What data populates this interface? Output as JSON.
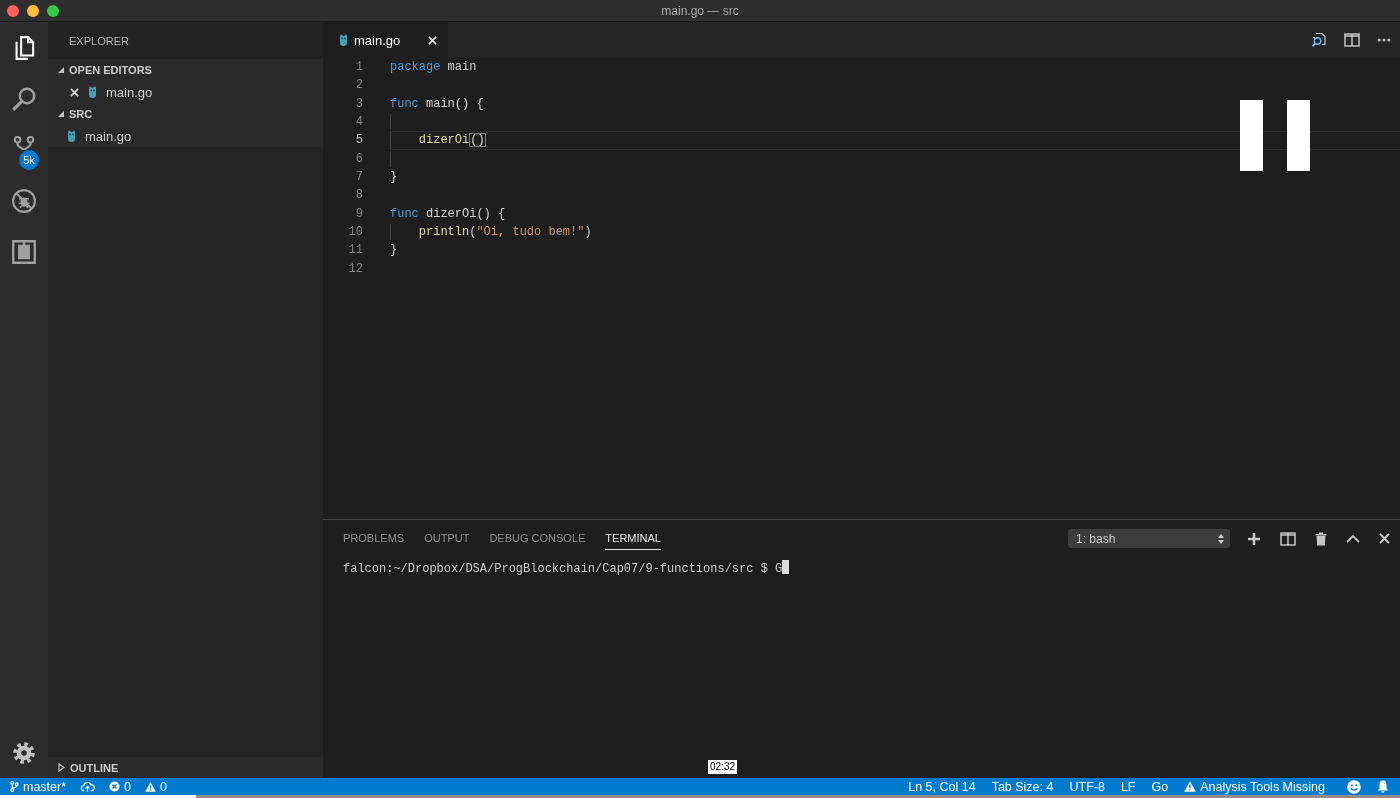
{
  "window": {
    "title": "main.go — src"
  },
  "activity_bar": {
    "items": [
      {
        "kind": "files",
        "selected": true
      },
      {
        "kind": "search",
        "selected": false
      },
      {
        "kind": "source_control",
        "selected": false,
        "badge": "5k"
      },
      {
        "kind": "debug",
        "selected": false
      },
      {
        "kind": "extensions",
        "selected": false
      }
    ]
  },
  "sidebar": {
    "title": "EXPLORER",
    "sections": [
      {
        "title": "OPEN EDITORS",
        "expanded": true,
        "items": [
          {
            "kind": "open_editor",
            "name": "main.go"
          }
        ]
      },
      {
        "title": "SRC",
        "expanded": true,
        "items": [
          {
            "kind": "file",
            "name": "main.go"
          }
        ]
      }
    ],
    "outline": {
      "title": "OUTLINE",
      "expanded": false
    }
  },
  "editor": {
    "tabs": [
      {
        "label": "main.go",
        "selected": true
      }
    ],
    "lines": [
      {
        "number": "1",
        "current": false,
        "indent_guide": false,
        "tokens": [
          {
            "kind": "keyword",
            "text": "package"
          },
          {
            "kind": "plain",
            "text": " main"
          }
        ]
      },
      {
        "number": "2",
        "current": false,
        "indent_guide": false
      },
      {
        "number": "3",
        "current": false,
        "indent_guide": false,
        "tokens": [
          {
            "kind": "keyword",
            "text": "func"
          },
          {
            "kind": "plain",
            "text": " main() {"
          }
        ]
      },
      {
        "number": "4",
        "current": false,
        "indent_guide": true
      },
      {
        "number": "5",
        "current": true,
        "indent_guide": true,
        "tokens": [
          {
            "kind": "function",
            "text": "dizerOi"
          },
          {
            "kind": "bracket_match",
            "text": "()"
          }
        ]
      },
      {
        "number": "6",
        "current": false,
        "indent_guide": true
      },
      {
        "number": "7",
        "current": false,
        "indent_guide": false,
        "tokens": [
          {
            "kind": "plain",
            "text": "}"
          }
        ]
      },
      {
        "number": "8",
        "current": false,
        "indent_guide": false
      },
      {
        "number": "9",
        "current": false,
        "indent_guide": false,
        "tokens": [
          {
            "kind": "keyword",
            "text": "func"
          },
          {
            "kind": "plain",
            "text": " dizerOi() {"
          }
        ]
      },
      {
        "number": "10",
        "current": false,
        "indent_guide": true,
        "tokens": [
          {
            "kind": "function",
            "text": "println"
          },
          {
            "kind": "plain",
            "text": "("
          },
          {
            "kind": "string",
            "text": "\"Oi, tudo bem!\""
          },
          {
            "kind": "plain",
            "text": ")"
          }
        ]
      },
      {
        "number": "11",
        "current": false,
        "indent_guide": false,
        "tokens": [
          {
            "kind": "plain",
            "text": "}"
          }
        ]
      },
      {
        "number": "12",
        "current": false,
        "indent_guide": false
      }
    ]
  },
  "panel": {
    "tabs": [
      {
        "label": "PROBLEMS",
        "selected": false
      },
      {
        "label": "OUTPUT",
        "selected": false
      },
      {
        "label": "DEBUG CONSOLE",
        "selected": false
      },
      {
        "label": "TERMINAL",
        "selected": true
      }
    ],
    "terminal_selector": "1: bash",
    "terminal_lines": [
      "falcon:~/Dropbox/DSA/ProgBlockchain/Cap07/9-functions/src $ G"
    ]
  },
  "status_bar": {
    "left": [
      {
        "kind": "branch",
        "text": "master*"
      },
      {
        "kind": "sync"
      },
      {
        "kind": "errors",
        "text": "0"
      },
      {
        "kind": "warnings",
        "text": "0"
      }
    ],
    "right": [
      {
        "kind": "text",
        "text": "Ln 5, Col 14"
      },
      {
        "kind": "text",
        "text": "Tab Size: 4"
      },
      {
        "kind": "text",
        "text": "UTF-8"
      },
      {
        "kind": "text",
        "text": "LF"
      },
      {
        "kind": "text",
        "text": "Go"
      },
      {
        "kind": "warning",
        "text": "Analysis Tools Missing"
      },
      {
        "kind": "feedback"
      },
      {
        "kind": "notifications"
      }
    ]
  },
  "video_player": {
    "paused": true,
    "time_tooltip": "02:32",
    "level": 0.14
  }
}
